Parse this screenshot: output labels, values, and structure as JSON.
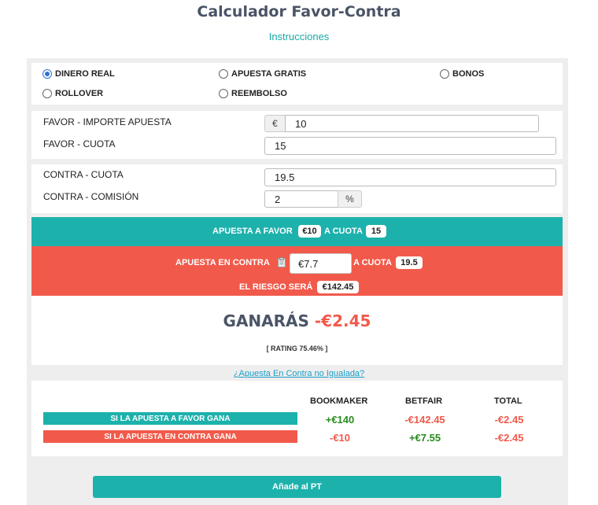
{
  "title": "Calculador Favor-Contra",
  "instructions_link": "Instrucciones",
  "bet_types": [
    {
      "label": "DINERO REAL",
      "checked": true
    },
    {
      "label": "APUESTA GRATIS",
      "checked": false
    },
    {
      "label": "BONOS",
      "checked": false
    },
    {
      "label": "ROLLOVER",
      "checked": false
    },
    {
      "label": "REEMBOLSO",
      "checked": false
    }
  ],
  "favor": {
    "stake_label": "FAVOR - IMPORTE APUESTA",
    "currency": "€",
    "stake_value": "10",
    "odds_label": "FAVOR - CUOTA",
    "odds_value": "15"
  },
  "contra": {
    "odds_label": "CONTRA - CUOTA",
    "odds_value": "19.5",
    "commission_label": "CONTRA - COMISIÓN",
    "commission_value": "2",
    "percent": "%"
  },
  "favor_band": {
    "text_a": "APUESTA A FAVOR",
    "stake": "€10",
    "text_b": "A CUOTA",
    "odds": "15"
  },
  "contra_band": {
    "text_a": "APUESTA EN CONTRA",
    "stake": "€7.7",
    "text_b": "A CUOTA",
    "odds": "19.5",
    "risk_text": "EL RIESGO SERÁ",
    "risk": "€142.45"
  },
  "result": {
    "win_label": "GANARÁS",
    "win_value": "-€2.45",
    "rating": "[ RATING 75.46% ]"
  },
  "unmatched_link": "¿Apuesta En Contra no Igualada?",
  "table": {
    "headers": [
      "BOOKMAKER",
      "BETFAIR",
      "TOTAL"
    ],
    "rows": [
      {
        "label": "SI LA APUESTA A FAVOR GANA",
        "color": "#1db1ac",
        "values": [
          "+€140",
          "-€142.45",
          "-€2.45"
        ]
      },
      {
        "label": "SI LA APUESTA EN CONTRA GANA",
        "color": "#f15a4b",
        "values": [
          "-€10",
          "+€7.55",
          "-€2.45"
        ]
      }
    ]
  },
  "add_pt_button": "Añade al PT",
  "colors": {
    "teal": "#1db1ac",
    "red": "#f15a4b",
    "green": "#2a8a1f",
    "link": "#1a9fc9"
  }
}
